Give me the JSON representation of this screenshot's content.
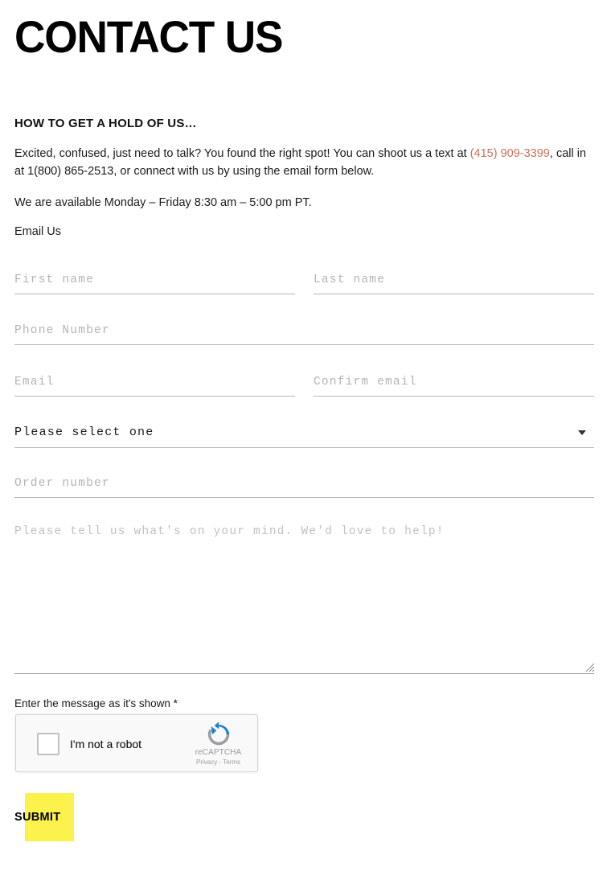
{
  "page": {
    "title": "CONTACT US",
    "sub_heading": "HOW TO GET A HOLD OF US…"
  },
  "intro": {
    "text_before_link": "Excited, confused, just need to talk? You found the right spot! You can shoot us a text at ",
    "phone_link": "(415) 909-3399",
    "text_after_link": ", call in at 1(800) 865-2513, or connect with us by using the email form below.",
    "hours": "We are available Monday – Friday 8:30 am – 5:00 pm PT.",
    "email_us": "Email Us",
    "link_color": "#c9715b"
  },
  "form": {
    "first_name": {
      "placeholder": "First name",
      "value": ""
    },
    "last_name": {
      "placeholder": "Last name",
      "value": ""
    },
    "phone": {
      "placeholder": "Phone Number",
      "value": ""
    },
    "email": {
      "placeholder": "Email",
      "value": ""
    },
    "confirm_email": {
      "placeholder": "Confirm email",
      "value": ""
    },
    "topic_select": {
      "selected": "Please select one"
    },
    "order_number": {
      "placeholder": "Order number",
      "value": ""
    },
    "message": {
      "placeholder": "Please tell us what's on your mind. We'd love to help!",
      "value": ""
    }
  },
  "captcha": {
    "label": "Enter the message as it's shown *",
    "checkbox_text": "I'm not a robot",
    "brand_name": "reCAPTCHA",
    "links": "Privacy - Terms"
  },
  "submit": {
    "label": "SUBMIT",
    "highlight_color": "#fbf24e"
  }
}
